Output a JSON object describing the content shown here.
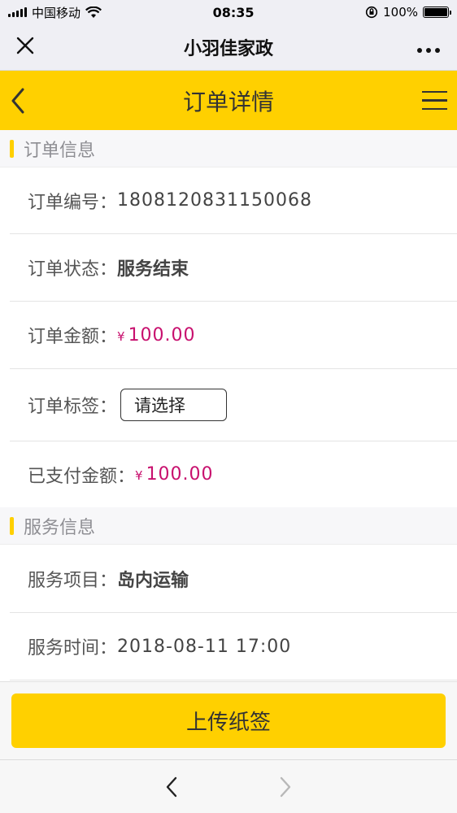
{
  "status_bar": {
    "carrier": "中国移动",
    "time": "08:35",
    "battery": "100%",
    "battery_level": 1.0
  },
  "wechat_bar": {
    "close_icon": "close-icon",
    "title": "小羽佳家政",
    "more_label": "•••"
  },
  "app_bar": {
    "back_icon": "chevron-left-icon",
    "title": "订单详情",
    "menu_icon": "hamburger-menu-icon"
  },
  "order_section": {
    "title": "订单信息",
    "rows": {
      "number_label": "订单编号：",
      "number_value": "1808120831150068",
      "status_label": "订单状态：",
      "status_value": "服务结束",
      "amount_label": "订单金额：",
      "amount_currency": "¥",
      "amount_value": "100.00",
      "tag_label": "订单标签：",
      "tag_placeholder": "请选择",
      "paid_label": "已支付金额：",
      "paid_currency": "¥",
      "paid_value": "100.00"
    }
  },
  "service_section": {
    "title": "服务信息",
    "rows": {
      "item_label": "服务项目：",
      "item_value": "岛内运输",
      "time_label": "服务时间：",
      "time_value": "2018-08-11 17:00"
    }
  },
  "actions": {
    "upload_label": "上传纸签"
  },
  "browser_nav": {
    "back_icon": "browser-back-icon",
    "forward_icon": "browser-forward-icon"
  },
  "colors": {
    "accent": "#ffd000",
    "money": "#c8106e",
    "section_bg": "#f7f7f9"
  }
}
